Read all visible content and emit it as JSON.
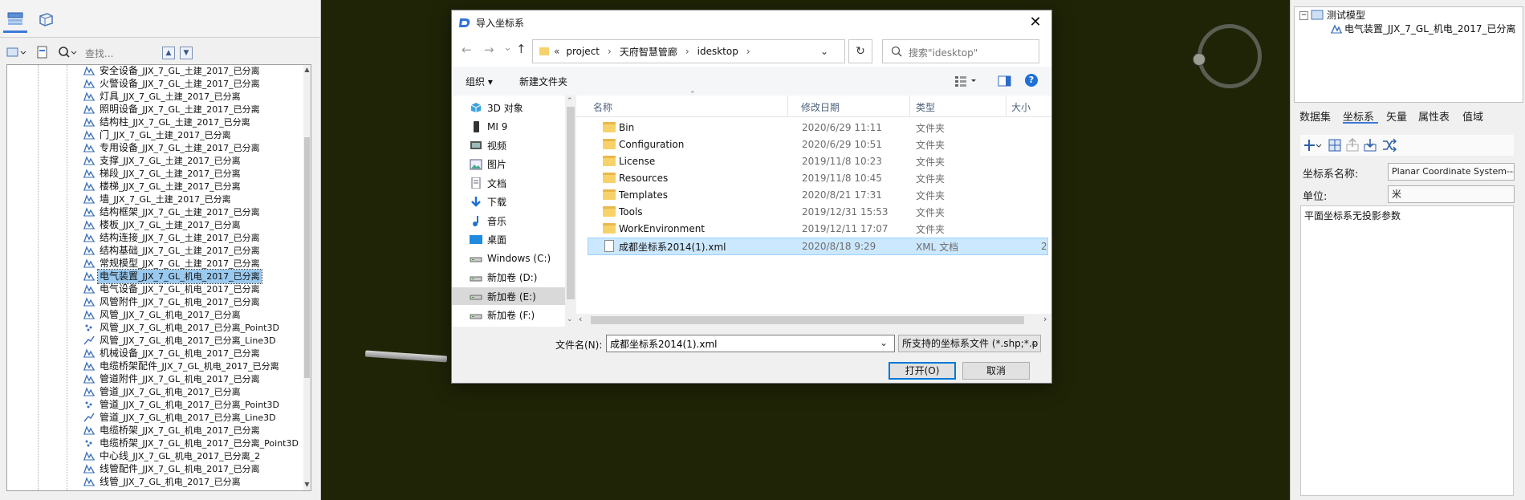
{
  "left_panel": {
    "search_placeholder": "查找...",
    "tree_items": [
      {
        "label": "安全设备",
        "suffix": "_JJX_7_GL_土建_2017_已分离",
        "icon": "dataset-icon"
      },
      {
        "label": "火警设备",
        "suffix": "_JJX_7_GL_土建_2017_已分离",
        "icon": "dataset-icon"
      },
      {
        "label": "灯具",
        "suffix": "_JJX_7_GL_土建_2017_已分离",
        "icon": "dataset-icon"
      },
      {
        "label": "照明设备",
        "suffix": "_JJX_7_GL_土建_2017_已分离",
        "icon": "dataset-icon"
      },
      {
        "label": "结构柱",
        "suffix": "_JJX_7_GL_土建_2017_已分离",
        "icon": "dataset-icon"
      },
      {
        "label": "门",
        "suffix": "_JJX_7_GL_土建_2017_已分离",
        "icon": "dataset-icon"
      },
      {
        "label": "专用设备",
        "suffix": "_JJX_7_GL_土建_2017_已分离",
        "icon": "dataset-icon"
      },
      {
        "label": "支撑",
        "suffix": "_JJX_7_GL_土建_2017_已分离",
        "icon": "dataset-icon"
      },
      {
        "label": "梯段",
        "suffix": "_JJX_7_GL_土建_2017_已分离",
        "icon": "dataset-icon"
      },
      {
        "label": "楼梯",
        "suffix": "_JJX_7_GL_土建_2017_已分离",
        "icon": "dataset-icon"
      },
      {
        "label": "墙",
        "suffix": "_JJX_7_GL_土建_2017_已分离",
        "icon": "dataset-icon"
      },
      {
        "label": "结构框架",
        "suffix": "_JJX_7_GL_土建_2017_已分离",
        "icon": "dataset-icon"
      },
      {
        "label": "楼板",
        "suffix": "_JJX_7_GL_土建_2017_已分离",
        "icon": "dataset-icon"
      },
      {
        "label": "结构连接",
        "suffix": "_JJX_7_GL_土建_2017_已分离",
        "icon": "dataset-icon"
      },
      {
        "label": "结构基础",
        "suffix": "_JJX_7_GL_土建_2017_已分离",
        "icon": "dataset-icon"
      },
      {
        "label": "常规模型",
        "suffix": "_JJX_7_GL_土建_2017_已分离",
        "icon": "dataset-icon"
      },
      {
        "label": "电气装置",
        "suffix": "_JJX_7_GL_机电_2017_已分离",
        "icon": "dataset-icon",
        "selected": true
      },
      {
        "label": "电气设备",
        "suffix": "_JJX_7_GL_机电_2017_已分离",
        "icon": "dataset-icon"
      },
      {
        "label": "风管附件",
        "suffix": "_JJX_7_GL_机电_2017_已分离",
        "icon": "dataset-icon"
      },
      {
        "label": "风管",
        "suffix": "_JJX_7_GL_机电_2017_已分离",
        "icon": "dataset-icon"
      },
      {
        "label": "风管",
        "suffix": "_JJX_7_GL_机电_2017_已分离_Point3D",
        "icon": "point3d-icon"
      },
      {
        "label": "风管",
        "suffix": "_JJX_7_GL_机电_2017_已分离_Line3D",
        "icon": "line3d-icon"
      },
      {
        "label": "机械设备",
        "suffix": "_JJX_7_GL_机电_2017_已分离",
        "icon": "dataset-icon"
      },
      {
        "label": "电缆桥架配件",
        "suffix": "_JJX_7_GL_机电_2017_已分离",
        "icon": "dataset-icon"
      },
      {
        "label": "管道附件",
        "suffix": "_JJX_7_GL_机电_2017_已分离",
        "icon": "dataset-icon"
      },
      {
        "label": "管道",
        "suffix": "_JJX_7_GL_机电_2017_已分离",
        "icon": "dataset-icon"
      },
      {
        "label": "管道",
        "suffix": "_JJX_7_GL_机电_2017_已分离_Point3D",
        "icon": "point3d-icon"
      },
      {
        "label": "管道",
        "suffix": "_JJX_7_GL_机电_2017_已分离_Line3D",
        "icon": "line3d-icon"
      },
      {
        "label": "电缆桥架",
        "suffix": "_JJX_7_GL_机电_2017_已分离",
        "icon": "dataset-icon"
      },
      {
        "label": "电缆桥架",
        "suffix": "_JJX_7_GL_机电_2017_已分离_Point3D",
        "icon": "point3d-icon"
      },
      {
        "label": "中心线",
        "suffix": "_JJX_7_GL_机电_2017_已分离_2",
        "icon": "dataset-icon"
      },
      {
        "label": "线管配件",
        "suffix": "_JJX_7_GL_机电_2017_已分离",
        "icon": "dataset-icon"
      },
      {
        "label": "线管",
        "suffix": "_JJX_7_GL_机电_2017_已分离",
        "icon": "dataset-icon"
      }
    ]
  },
  "right_panel": {
    "layers": {
      "root": "测试模型",
      "child": "电气装置_JJX_7_GL_机电_2017_已分离"
    },
    "tabs": [
      "数据集",
      "坐标系",
      "矢量",
      "属性表",
      "值域"
    ],
    "active_tab": "坐标系",
    "coord_name_label": "坐标系名称:",
    "coord_name_value": "Planar Coordinate System---m",
    "unit_label": "单位:",
    "unit_value": "米",
    "param_text": "平面坐标系无投影参数"
  },
  "dialog": {
    "title": "导入坐标系",
    "breadcrumb": [
      "project",
      "天府智慧管廊",
      "idesktop"
    ],
    "breadcrumb_prefix": "«",
    "search_placeholder": "搜索\"idesktop\"",
    "organize_label": "组织 ▾",
    "new_folder_label": "新建文件夹",
    "nav_items": [
      {
        "label": "3D 对象",
        "icon": "cube-icon"
      },
      {
        "label": "MI 9",
        "icon": "phone-icon"
      },
      {
        "label": "视频",
        "icon": "video-icon"
      },
      {
        "label": "图片",
        "icon": "picture-icon"
      },
      {
        "label": "文档",
        "icon": "document-icon"
      },
      {
        "label": "下载",
        "icon": "download-icon"
      },
      {
        "label": "音乐",
        "icon": "music-icon"
      },
      {
        "label": "桌面",
        "icon": "desktop-icon"
      },
      {
        "label": "Windows (C:)",
        "icon": "drive-icon"
      },
      {
        "label": "新加卷 (D:)",
        "icon": "drive-icon"
      },
      {
        "label": "新加卷 (E:)",
        "icon": "drive-icon",
        "selected": true
      },
      {
        "label": "新加卷 (F:)",
        "icon": "drive-icon"
      }
    ],
    "columns": {
      "name": "名称",
      "date": "修改日期",
      "type": "类型",
      "size": "大小"
    },
    "files": [
      {
        "name": "Bin",
        "date": "2020/6/29 11:11",
        "type": "文件夹",
        "size": "",
        "kind": "folder"
      },
      {
        "name": "Configuration",
        "date": "2020/6/29 10:51",
        "type": "文件夹",
        "size": "",
        "kind": "folder"
      },
      {
        "name": "License",
        "date": "2019/11/8 10:23",
        "type": "文件夹",
        "size": "",
        "kind": "folder"
      },
      {
        "name": "Resources",
        "date": "2019/11/8 10:45",
        "type": "文件夹",
        "size": "",
        "kind": "folder"
      },
      {
        "name": "Templates",
        "date": "2020/8/21 17:31",
        "type": "文件夹",
        "size": "",
        "kind": "folder"
      },
      {
        "name": "Tools",
        "date": "2019/12/31 15:53",
        "type": "文件夹",
        "size": "",
        "kind": "folder"
      },
      {
        "name": "WorkEnvironment",
        "date": "2019/12/11 17:07",
        "type": "文件夹",
        "size": "",
        "kind": "folder"
      },
      {
        "name": "成都坐标系2014(1).xml",
        "date": "2020/8/18 9:29",
        "type": "XML 文档",
        "size": "2",
        "kind": "xml",
        "selected": true
      }
    ],
    "filename_label": "文件名(N):",
    "filename_value": "成都坐标系2014(1).xml",
    "filter_value": "所支持的坐标系文件 (*.shp;*.p",
    "open_label": "打开(O)",
    "cancel_label": "取消"
  },
  "colors": {
    "canvas": "#1f2407",
    "selection": "#99c9ef",
    "accent": "#0078d7"
  }
}
